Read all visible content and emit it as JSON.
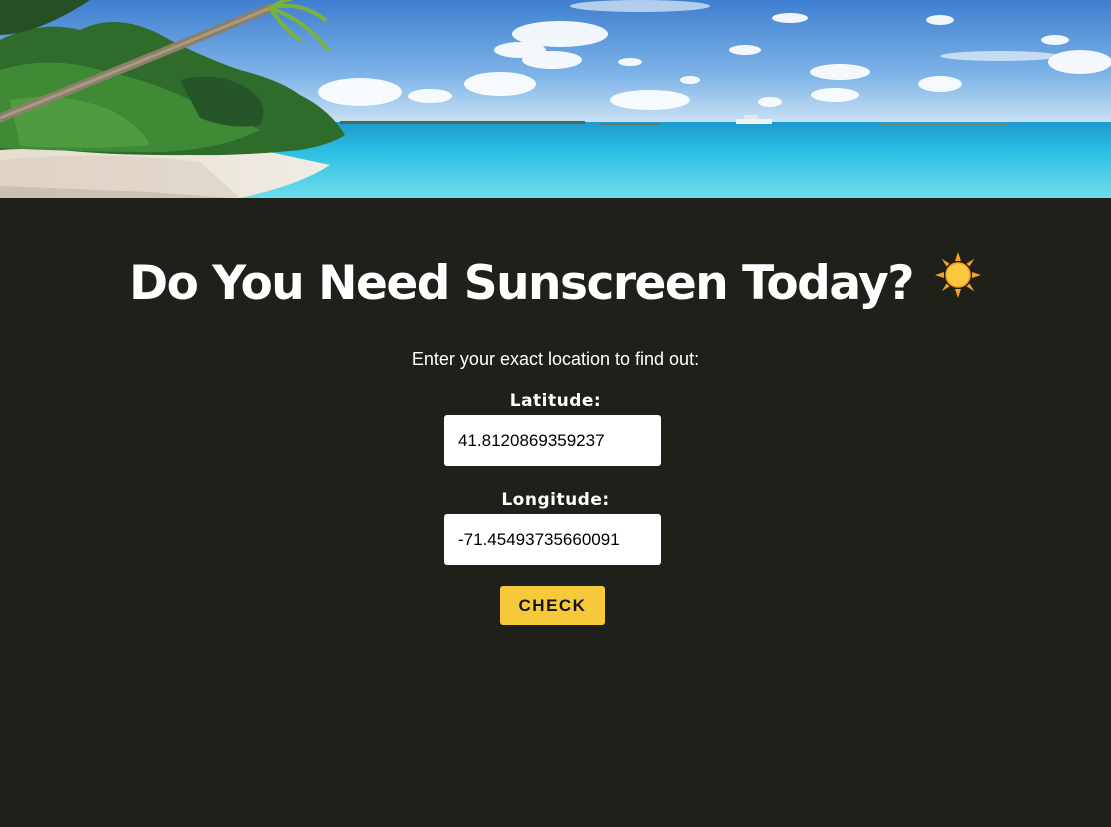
{
  "hero": {
    "image": "tropical-beach-photo"
  },
  "header": {
    "title": "Do You Need Sunscreen Today?",
    "title_icon": "sun-icon"
  },
  "form": {
    "intro": "Enter your exact location to find out:",
    "latitude": {
      "label": "Latitude:",
      "value": "41.8120869359237"
    },
    "longitude": {
      "label": "Longitude:",
      "value": "-71.45493735660091"
    },
    "submit_label": "CHECK"
  },
  "colors": {
    "background": "#20201a",
    "accent": "#f5c93a",
    "text": "#ffffff"
  }
}
